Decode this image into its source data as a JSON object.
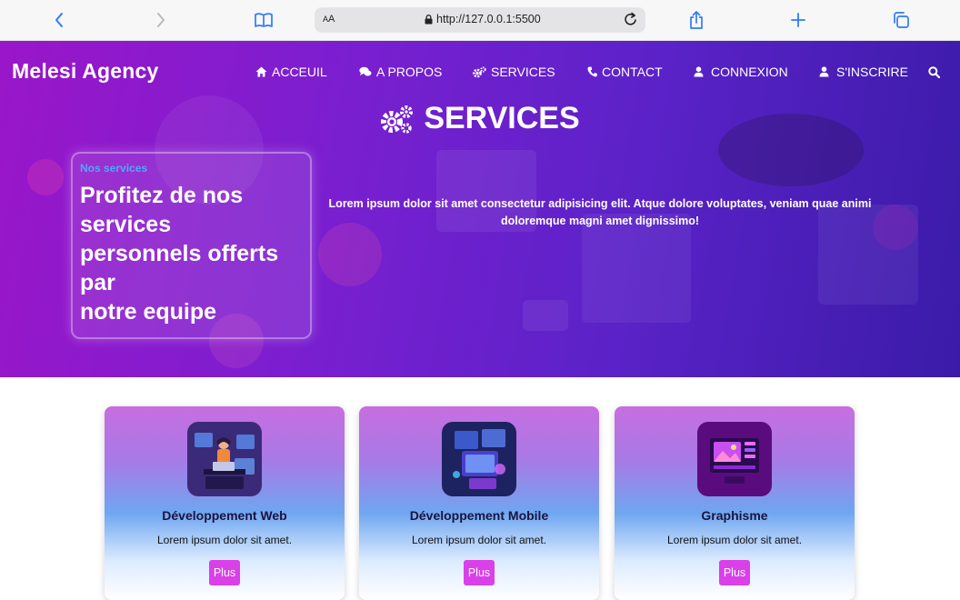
{
  "browser": {
    "text_size_label": "AA",
    "url": "http://127.0.0.1:5500"
  },
  "site": {
    "brand": "Melesi Agency",
    "nav": [
      {
        "label": "ACCEUIL",
        "icon": "home-icon"
      },
      {
        "label": "A PROPOS",
        "icon": "comments-icon"
      },
      {
        "label": "SERVICES",
        "icon": "gears-icon"
      },
      {
        "label": "CONTACT",
        "icon": "phone-icon"
      },
      {
        "label": "CONNEXION",
        "icon": "user-icon"
      },
      {
        "label": "S'INSCRIRE",
        "icon": "user-icon"
      }
    ],
    "search_icon": "search-icon"
  },
  "hero": {
    "title": "SERVICES",
    "title_icon": "gears-icon",
    "kicker": "Nos services",
    "headline_lines": [
      "Profitez de nos",
      "services",
      "personnels offerts",
      "par",
      "notre equipe"
    ],
    "lead": "Lorem ipsum dolor sit amet consectetur adipisicing elit. Atque dolore voluptates, veniam quae animi doloremque magni amet dignissimo!"
  },
  "cards": [
    {
      "title": "Développement Web",
      "desc": "Lorem ipsum dolor sit amet.",
      "button": "Plus",
      "image": "web-developer-illustration"
    },
    {
      "title": "Développement Mobile",
      "desc": "Lorem ipsum dolor sit amet.",
      "button": "Plus",
      "image": "mobile-development-illustration"
    },
    {
      "title": "Graphisme",
      "desc": "Lorem ipsum dolor sit amet.",
      "button": "Plus",
      "image": "graphic-design-illustration"
    }
  ],
  "colors": {
    "hero_start": "#9a16c9",
    "hero_end": "#3a1ba8",
    "accent_button": "#d940e8",
    "kicker": "#4fa8ff",
    "safari_blue": "#2f7bf5"
  }
}
